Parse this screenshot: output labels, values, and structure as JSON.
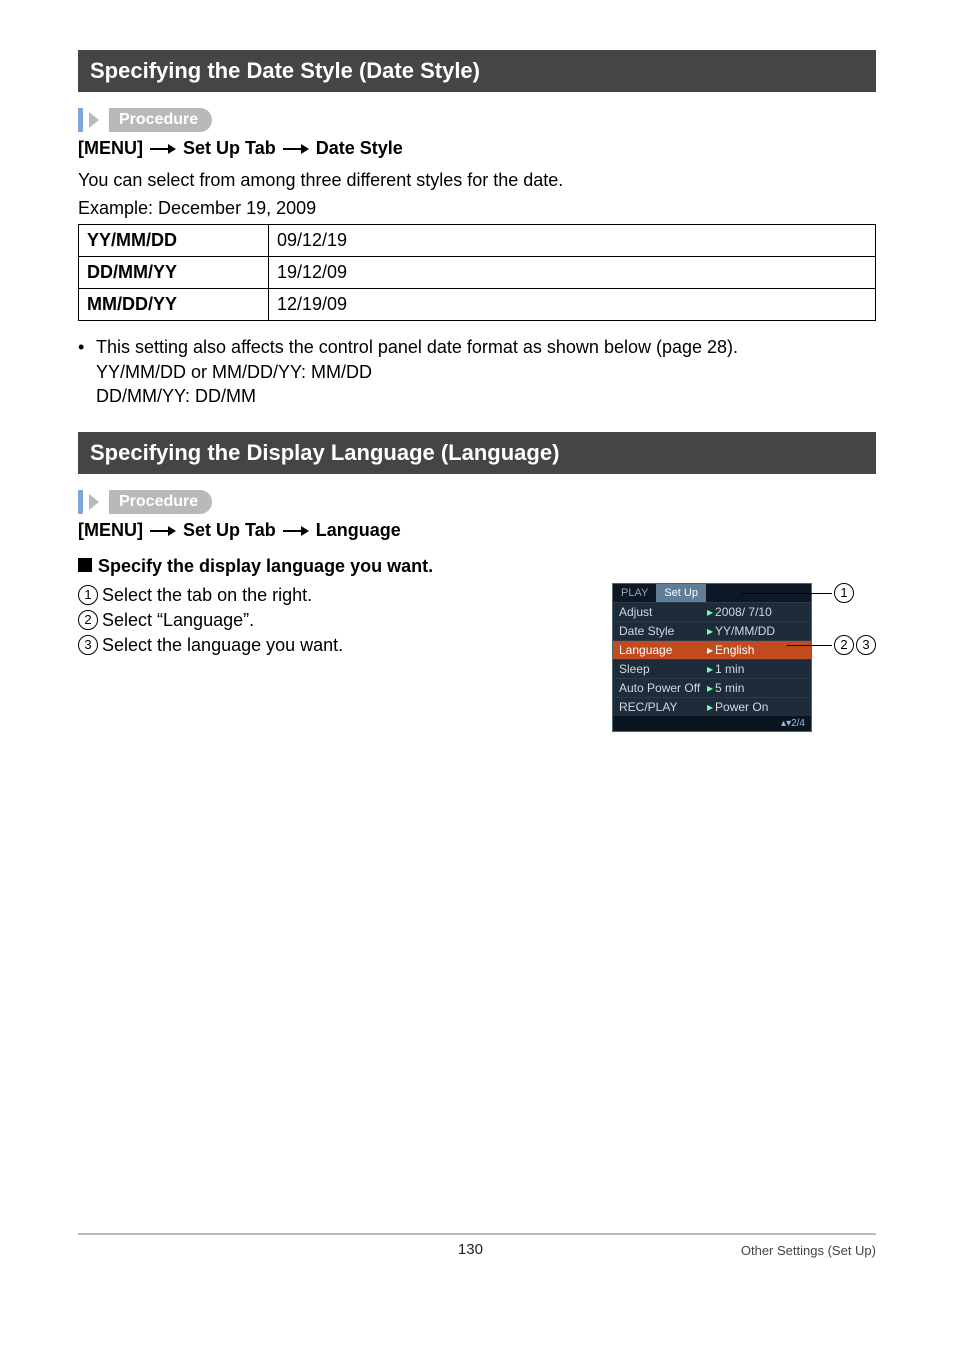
{
  "section1": {
    "title": "Specifying the Date Style (Date Style)",
    "procedure_label": "Procedure",
    "path_parts": [
      "[MENU]",
      "Set Up Tab",
      "Date Style"
    ],
    "intro_line": "You can select from among three different styles for the date.",
    "example_line": "Example: December 19, 2009",
    "table": [
      {
        "format": "YY/MM/DD",
        "value": "09/12/19"
      },
      {
        "format": "DD/MM/YY",
        "value": "19/12/09"
      },
      {
        "format": "MM/DD/YY",
        "value": "12/19/09"
      }
    ],
    "note1": "This setting also affects the control panel date format as shown below (page 28).",
    "note2": "YY/MM/DD or MM/DD/YY: MM/DD",
    "note3": "DD/MM/YY: DD/MM"
  },
  "section2": {
    "title": "Specifying the Display Language (Language)",
    "procedure_label": "Procedure",
    "path_parts": [
      "[MENU]",
      "Set Up Tab",
      "Language"
    ],
    "subhead": "Specify the display language you want.",
    "steps": [
      "Select the tab on the right.",
      "Select “Language”.",
      "Select the language you want."
    ],
    "callouts": {
      "c1": "1",
      "c2": "2",
      "c3": "3"
    }
  },
  "camera_menu": {
    "tabs": {
      "inactive": "PLAY",
      "active": "Set Up"
    },
    "rows": [
      {
        "k": "Adjust",
        "v": "2008/  7/10"
      },
      {
        "k": "Date Style",
        "v": "YY/MM/DD"
      },
      {
        "k": "Language",
        "v": "English",
        "hl": true
      },
      {
        "k": "Sleep",
        "v": "1 min"
      },
      {
        "k": "Auto Power Off",
        "v": "5 min"
      },
      {
        "k": "REC/PLAY",
        "v": "Power On"
      }
    ],
    "footer": "▴▾2/4"
  },
  "footer": {
    "page_number": "130",
    "right": "Other Settings (Set Up)"
  }
}
